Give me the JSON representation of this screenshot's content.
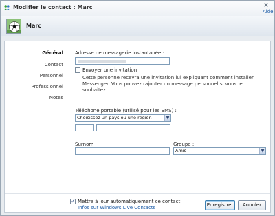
{
  "window": {
    "title": "Modifier le contact : Marc",
    "help": "Aide",
    "close_glyph": "×"
  },
  "contact": {
    "name": "Marc"
  },
  "nav": {
    "items": [
      {
        "label": "Général",
        "active": true
      },
      {
        "label": "Contact",
        "active": false
      },
      {
        "label": "Personnel",
        "active": false
      },
      {
        "label": "Professionnel",
        "active": false
      },
      {
        "label": "Notes",
        "active": false
      }
    ]
  },
  "form": {
    "im_label": "Adresse de messagerie instantanée :",
    "im_value": "",
    "invite_label": "Envoyer une invitation",
    "invite_checked": false,
    "invite_desc": "Cette personne recevra une invitation lui expliquant comment installer Messenger. Vous pouvez rajouter un message personnel si vous le souhaitez.",
    "mobile_label": "Téléphone portable (utilisé pour les SMS) :",
    "country_select": "Choisissez un pays ou une région",
    "phone_prefix_value": "",
    "phone_number_value": "",
    "nickname_label": "Surnom :",
    "nickname_value": "",
    "group_label": "Groupe :",
    "group_select": "Amis"
  },
  "footer": {
    "auto_update_label": "Mettre à jour automatiquement ce contact",
    "auto_update_checked": true,
    "info_link": "Infos sur Windows Live Contacts",
    "save_button": "Enregistrer",
    "cancel_button": "Annuler"
  },
  "icons": {
    "app": "windows-live-messenger-icon",
    "avatar": "soccer-ball-avatar",
    "dropdown": "chevron-down-icon",
    "close": "close-icon"
  },
  "colors": {
    "link": "#1a5aa6",
    "input_border": "#7f9db9",
    "panel_bg": "#ffffff",
    "window_bg": "#e8ecf0"
  }
}
